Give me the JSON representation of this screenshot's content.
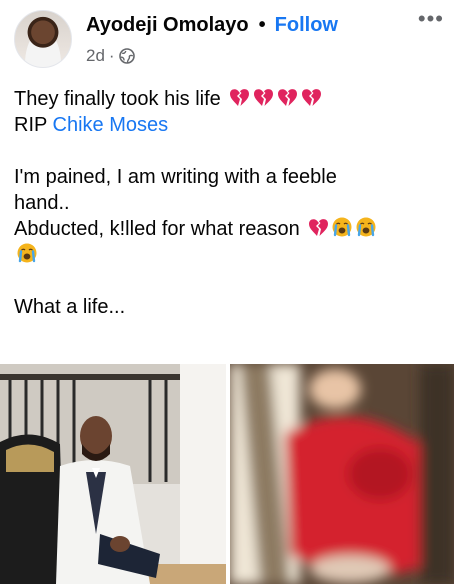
{
  "post": {
    "author": "Ayodeji Omolayo",
    "separator": "•",
    "follow_label": "Follow",
    "time": "2d",
    "time_separator": "·",
    "audience_icon": "globe-icon",
    "more_label": "•••"
  },
  "content": {
    "line1_text": "They finally took his life",
    "line1_emoji_icon": "broken-heart-icon",
    "line1_emoji_count": 4,
    "line2_prefix": "RIP",
    "line2_link": "Chike Moses",
    "line3": "I'm pained, I am writing with a feeble",
    "line4": "hand..",
    "line5_text": "Abducted, k!lled for what reason",
    "line5_emoji_icons": [
      "broken-heart-icon",
      "crying-face-icon",
      "crying-face-icon"
    ],
    "line6_emoji_icon": "crying-face-icon",
    "line7": "What a life..."
  },
  "colors": {
    "link": "#1877f2",
    "text": "#050505",
    "meta": "#65676b",
    "broken_heart": "#e0245e",
    "crying_face": "#f5b41c"
  }
}
